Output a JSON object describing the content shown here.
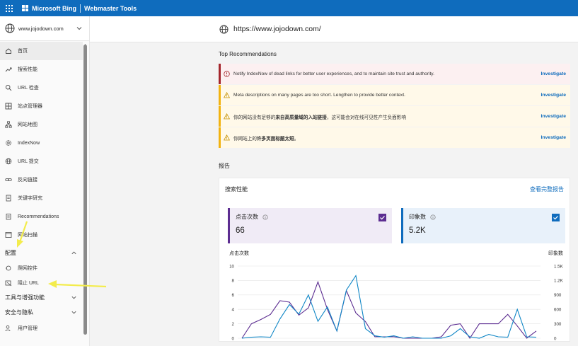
{
  "topbar": {
    "brand": "Microsoft Bing",
    "product": "Webmaster Tools"
  },
  "site_selector": {
    "value": "www.jojodown.com"
  },
  "sidebar": {
    "items": [
      {
        "label": "首页",
        "icon": "home-icon",
        "active": true
      },
      {
        "label": "搜索性能",
        "icon": "trend-icon"
      },
      {
        "label": "URL 检查",
        "icon": "search-icon"
      },
      {
        "label": "站点管理器",
        "icon": "grid-icon"
      },
      {
        "label": "网站地图",
        "icon": "sitemap-icon"
      },
      {
        "label": "IndexNow",
        "icon": "gear-icon"
      },
      {
        "label": "URL 提交",
        "icon": "globe-icon"
      },
      {
        "label": "反向链接",
        "icon": "link-icon"
      },
      {
        "label": "关键字研究",
        "icon": "document-icon"
      },
      {
        "label": "Recommendations",
        "icon": "clipboard-icon"
      },
      {
        "label": "网站扫描",
        "icon": "scan-icon"
      }
    ],
    "config_section": {
      "label": "配置",
      "items": [
        {
          "label": "爬网控件",
          "icon": "crawl-icon"
        },
        {
          "label": "阻止 URL",
          "icon": "block-icon"
        }
      ]
    },
    "tools_section": {
      "label": "工具与增强功能"
    },
    "security_section": {
      "label": "安全与隐私"
    },
    "user_item": {
      "label": "用户管理",
      "icon": "user-icon"
    }
  },
  "main": {
    "url": "https://www.jojodown.com/",
    "top_recommendations_title": "Top Recommendations",
    "recommendations": [
      {
        "type": "error",
        "text": "Notify IndexNow of dead links for better user experiences, and to maintain site trust and authority.",
        "action": "Investigate"
      },
      {
        "type": "warning",
        "text": "Meta descriptions on many pages are too short. Lengthen to provide better context.",
        "action": "Investigate"
      },
      {
        "type": "warning",
        "text_pre": "你的网站没有足够的",
        "text_bold": "来自高质量域的入站链接",
        "text_post": "，这可能会对在线可见性产生负面影响",
        "action": "Investigate"
      },
      {
        "type": "warning",
        "text_pre": "你网站上的",
        "text_bold": "许多页面标题太短",
        "text_post": "。",
        "action": "Investigate"
      }
    ],
    "report_title": "报告",
    "report_card": {
      "title": "搜索性能",
      "full_report": "查看完整报告",
      "clicks": {
        "label": "点击次数",
        "value": "66",
        "color": "#5c2d91"
      },
      "impressions": {
        "label": "印象数",
        "value": "5.2K",
        "color": "#0f6cbd"
      }
    }
  },
  "chart_data": {
    "type": "line",
    "left_axis_label": "点击次数",
    "right_axis_label": "印象数",
    "left_ticks": [
      "0",
      "2",
      "4",
      "6",
      "8",
      "10"
    ],
    "right_ticks": [
      "0",
      "300",
      "600",
      "900",
      "1.2K",
      "1.5K"
    ],
    "x_tick_labels": [
      "17 Aug",
      "24 Aug",
      "31 Aug",
      "07 Sep"
    ],
    "ylim_left": [
      0,
      10
    ],
    "ylim_right": [
      0,
      1500
    ],
    "series": [
      {
        "name": "点击次数",
        "axis": "left",
        "color": "#5c2d91",
        "values": [
          0,
          2,
          2.6,
          3.3,
          5.2,
          5,
          3.2,
          4.2,
          7.8,
          4,
          1,
          6.6,
          3.5,
          2.3,
          0.2,
          0.2,
          0.2,
          0,
          0,
          0,
          0,
          0.2,
          1.8,
          2,
          0,
          2,
          2,
          2,
          3.3,
          1.7,
          0,
          1
        ],
        "x_index": [
          0,
          1,
          2,
          3,
          4,
          5,
          6,
          7,
          8,
          9,
          10,
          11,
          12,
          13,
          14,
          15,
          16,
          17,
          18,
          19,
          20,
          21,
          22,
          23,
          24,
          25,
          26,
          27,
          28,
          29,
          30,
          31
        ]
      },
      {
        "name": "印象数",
        "axis": "right",
        "color": "#0f86c6",
        "values": [
          0,
          20,
          30,
          20,
          400,
          700,
          500,
          900,
          350,
          650,
          150,
          1000,
          1300,
          200,
          50,
          20,
          50,
          0,
          30,
          0,
          0,
          0,
          50,
          200,
          30,
          0,
          80,
          30,
          20,
          600,
          30,
          20
        ],
        "x_index": [
          0,
          1,
          2,
          3,
          4,
          5,
          6,
          7,
          8,
          9,
          10,
          11,
          12,
          13,
          14,
          15,
          16,
          17,
          18,
          19,
          20,
          21,
          22,
          23,
          24,
          25,
          26,
          27,
          28,
          29,
          30,
          31
        ]
      }
    ],
    "grid": true,
    "legend": "none"
  }
}
